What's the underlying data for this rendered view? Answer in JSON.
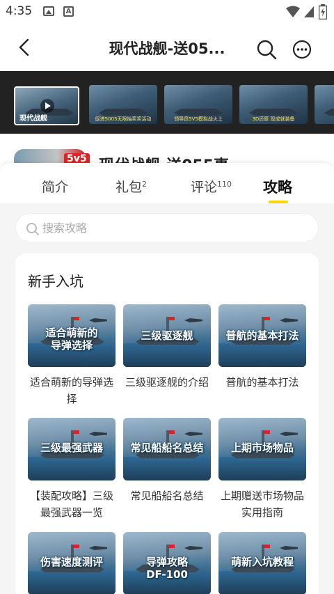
{
  "status_bar": {
    "time": "4:35"
  },
  "header": {
    "title": "现代战舰-送05..."
  },
  "media": {
    "thumbnails": [
      {
        "logo": "现代战舰",
        "caption": ""
      },
      {
        "caption": "促进5005无限抽奖奖活动"
      },
      {
        "caption": "领导员5V5模拟战火上"
      },
      {
        "caption": "3D还原  现成就装备"
      },
      {
        "caption": ""
      }
    ]
  },
  "game": {
    "name": "现代战舰-送055事",
    "badge": "5v5"
  },
  "tabs": [
    {
      "label": "简介",
      "count": ""
    },
    {
      "label": "礼包",
      "count": "2"
    },
    {
      "label": "评论",
      "count": "110"
    },
    {
      "label": "攻略",
      "count": ""
    }
  ],
  "search": {
    "placeholder": "搜索攻略"
  },
  "section": {
    "title": "新手入坑",
    "guides": [
      {
        "overlay": [
          "适合萌新的",
          "导弹选择"
        ],
        "caption": "适合萌新的导弹选择"
      },
      {
        "overlay": [
          "三级驱逐舰"
        ],
        "caption": "三级驱逐舰的介绍"
      },
      {
        "overlay": [
          "普航的基本打法"
        ],
        "caption": "普航的基本打法"
      },
      {
        "overlay": [
          "三级最强武器"
        ],
        "caption": "【装配攻略】三级最强武器一览"
      },
      {
        "overlay": [
          "常见船船名总结"
        ],
        "caption": "常见船船名总结"
      },
      {
        "overlay": [
          "上期市场物品"
        ],
        "caption": "上期赠送市场物品实用指南"
      },
      {
        "overlay": [
          "伤害速度测评"
        ],
        "caption": ""
      },
      {
        "overlay": [
          "导弹攻略",
          "DF-100"
        ],
        "caption": ""
      },
      {
        "overlay": [
          "萌新入坑教程"
        ],
        "caption": ""
      }
    ]
  },
  "colors": {
    "accent": "#ffd400",
    "badge": "#e02323",
    "media_bg": "#222222",
    "content_bg": "#f5f5f5"
  }
}
